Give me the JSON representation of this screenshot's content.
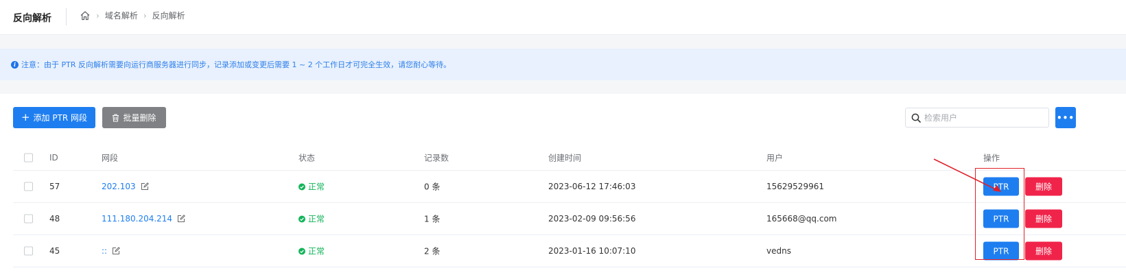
{
  "header": {
    "title": "反向解析",
    "breadcrumb": [
      "域名解析",
      "反向解析"
    ]
  },
  "notice": {
    "text": "注意：由于 PTR 反向解析需要向运行商服务器进行同步，记录添加或变更后需要 1 ~ 2 个工作日才可完全生效，请您耐心等待。"
  },
  "toolbar": {
    "add_label": "添加 PTR 网段",
    "bulk_delete_label": "批量删除",
    "more_label": "•••",
    "search_placeholder": "检索用户"
  },
  "table": {
    "columns": {
      "id": "ID",
      "segment": "网段",
      "status": "状态",
      "count": "记录数",
      "created": "创建时间",
      "user": "用户",
      "ops": "操作"
    },
    "rows": [
      {
        "id": "57",
        "segment": "202.103",
        "status": "正常",
        "count": "0 条",
        "created": "2023-06-12 17:46:03",
        "user": "15629529961"
      },
      {
        "id": "48",
        "segment": "111.180.204.214",
        "status": "正常",
        "count": "1 条",
        "created": "2023-02-09 09:56:56",
        "user": "165668@qq.com"
      },
      {
        "id": "45",
        "segment": "::",
        "status": "正常",
        "count": "2 条",
        "created": "2023-01-16 10:07:10",
        "user": "vedns"
      }
    ],
    "ptr_label": "PTR",
    "delete_label": "删除"
  },
  "colors": {
    "primary": "#1e7ef0",
    "danger": "#f0244a",
    "success": "#13b45a",
    "annotation": "#e0202a"
  },
  "icons": {
    "home": "home-icon",
    "info": "info-icon",
    "trash": "trash-icon",
    "search": "search-icon",
    "edit": "edit-icon",
    "status_ok": "check-circle-icon"
  }
}
